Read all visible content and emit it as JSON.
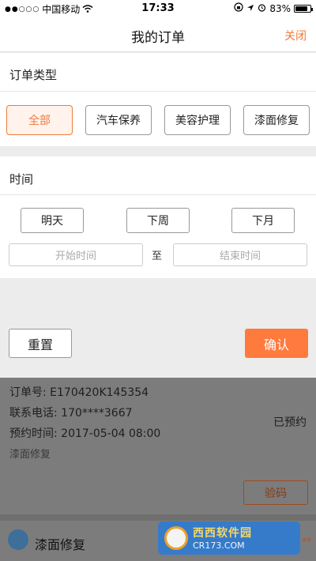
{
  "status_bar": {
    "carrier": "中国移动",
    "signal_dots": "●●○○○",
    "time": "17:33",
    "battery": "83%",
    "battery_level": 0.83
  },
  "nav": {
    "title": "我的订单",
    "close": "关闭"
  },
  "filter": {
    "type_title": "订单类型",
    "types": [
      "全部",
      "汽车保养",
      "美容护理",
      "漆面修复"
    ],
    "selected_type": "全部",
    "time_title": "时间",
    "quick_times": [
      "明天",
      "下周",
      "下月"
    ],
    "start_placeholder": "开始时间",
    "range_sep": "至",
    "end_placeholder": "结束时间",
    "reset": "重置",
    "confirm": "确认"
  },
  "order": {
    "order_no_label": "订单号:",
    "order_no": "E170420K145354",
    "phone_label": "联系电话:",
    "phone": "170****3667",
    "appointment_label": "预约时间:",
    "appointment": "2017-05-04 08:00",
    "service": "漆面修复",
    "status": "已预约",
    "verify": "验码"
  },
  "next_order": {
    "title": "漆面修复"
  },
  "watermark": {
    "name": "西西软件园",
    "url": "CR173.COM",
    "stars": "**"
  },
  "colors": {
    "accent": "#f07a3c",
    "confirm": "#ff7a3d"
  }
}
